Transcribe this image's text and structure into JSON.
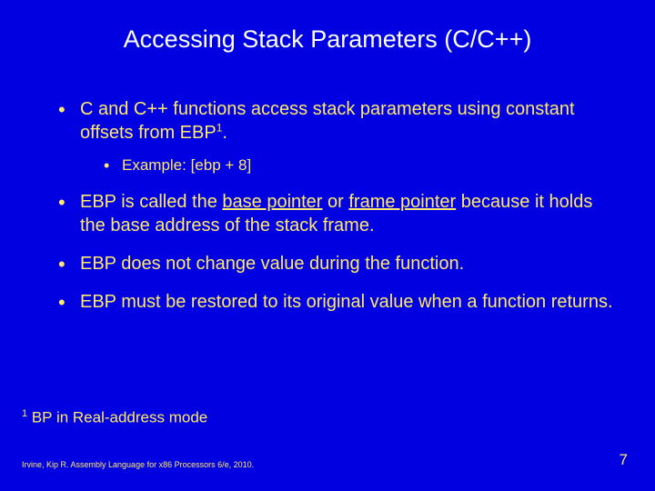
{
  "title": "Accessing Stack Parameters (C/C++)",
  "bullets": {
    "b1_pre": "C and C++ functions access stack parameters using constant offsets from EBP",
    "b1_sup": "1",
    "b1_post": ".",
    "b1_sub": "Example: [ebp + 8]",
    "b2_pre": "EBP is called the ",
    "b2_u1": "base pointer",
    "b2_mid": " or ",
    "b2_u2": "frame pointer",
    "b2_post": " because it holds the base address of the stack frame.",
    "b3": "EBP does not change value during the function.",
    "b4": "EBP must be restored to its original value when a function returns."
  },
  "footnote": {
    "sup": "1",
    "text": " BP in Real-address mode"
  },
  "citation": "Irvine, Kip R. Assembly Language for x86 Processors 6/e, 2010.",
  "page": "7"
}
